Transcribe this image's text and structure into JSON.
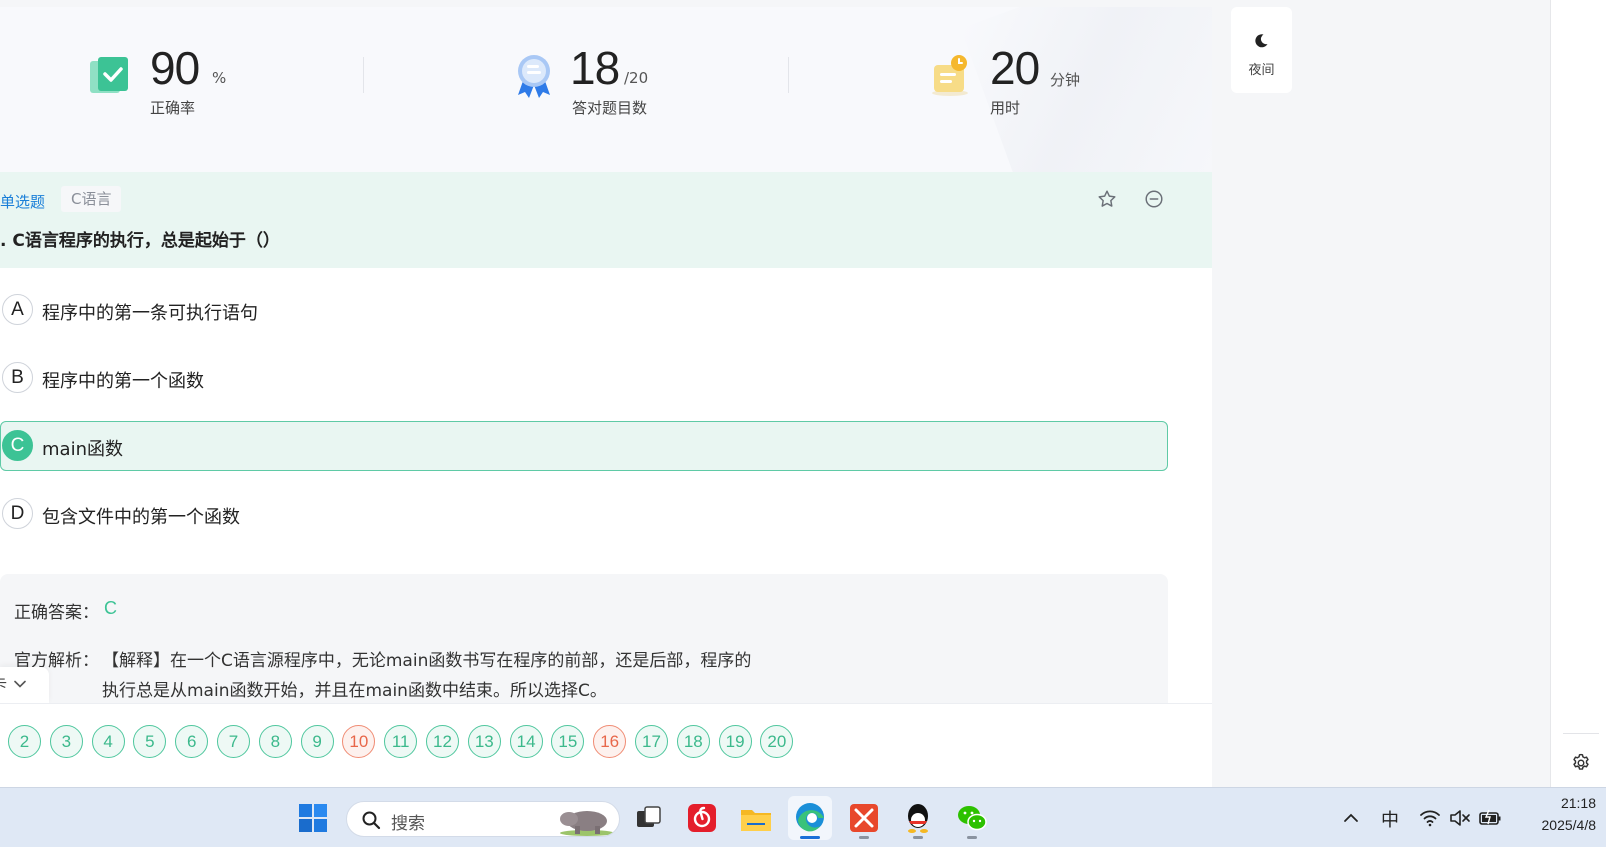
{
  "stats": {
    "accuracy": {
      "value": "90",
      "unit": "%",
      "label": "正确率"
    },
    "correct": {
      "value": "18",
      "unit": "/20",
      "label": "答对题目数"
    },
    "time": {
      "value": "20",
      "unit": "分钟",
      "label": "用时"
    }
  },
  "question": {
    "type": "单选题",
    "tag": "C语言",
    "text": ". C语言程序的执行，总是起始于（）",
    "options": [
      {
        "letter": "A",
        "text": "程序中的第一条可执行语句"
      },
      {
        "letter": "B",
        "text": "程序中的第一个函数"
      },
      {
        "letter": "C",
        "text": "main函数"
      },
      {
        "letter": "D",
        "text": "包含文件中的第一个函数"
      }
    ],
    "correct_option": "C"
  },
  "answer": {
    "label": "正确答案：",
    "value": "C",
    "explanation_label": "官方解析：",
    "explanation": "【解释】在一个C语言源程序中，无论main函数书写在程序的前部，还是后部，程序的执行总是从main函数开始，并且在main函数中结束。所以选择C。"
  },
  "card_toggle": {
    "label": "卡"
  },
  "numbers": [
    {
      "n": "2",
      "status": "correct"
    },
    {
      "n": "3",
      "status": "correct"
    },
    {
      "n": "4",
      "status": "correct"
    },
    {
      "n": "5",
      "status": "correct"
    },
    {
      "n": "6",
      "status": "correct"
    },
    {
      "n": "7",
      "status": "correct"
    },
    {
      "n": "8",
      "status": "correct"
    },
    {
      "n": "9",
      "status": "correct"
    },
    {
      "n": "10",
      "status": "wrong"
    },
    {
      "n": "11",
      "status": "correct"
    },
    {
      "n": "12",
      "status": "correct"
    },
    {
      "n": "13",
      "status": "correct"
    },
    {
      "n": "14",
      "status": "correct"
    },
    {
      "n": "15",
      "status": "correct"
    },
    {
      "n": "16",
      "status": "wrong"
    },
    {
      "n": "17",
      "status": "correct"
    },
    {
      "n": "18",
      "status": "correct"
    },
    {
      "n": "19",
      "status": "correct"
    },
    {
      "n": "20",
      "status": "correct"
    }
  ],
  "night_mode": {
    "label": "夜间"
  },
  "taskbar": {
    "search_placeholder": "搜索",
    "ime": "中",
    "time": "21:18",
    "date": "2025/4/8"
  },
  "colors": {
    "accent_green": "#3cc395",
    "wrong_red": "#e8674a",
    "type_blue": "#1a7fd8"
  }
}
